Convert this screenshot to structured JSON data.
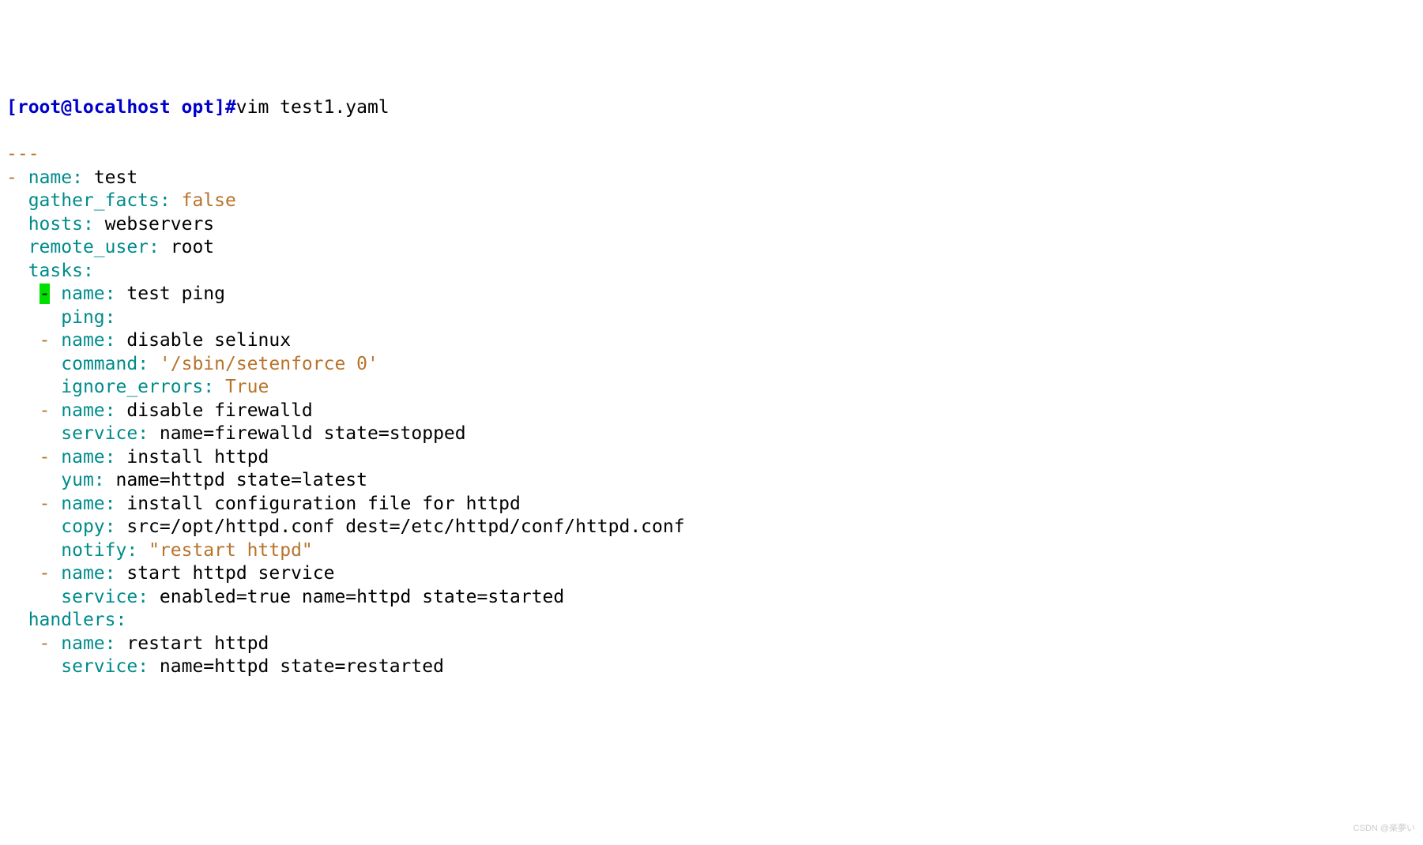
{
  "prompt": "[root@localhost opt]#",
  "command": "vim test1.yaml",
  "doc_start": "---",
  "play": {
    "name_key": "name",
    "name_val": "test",
    "gather_key": "gather_facts",
    "gather_val": "false",
    "hosts_key": "hosts",
    "hosts_val": "webservers",
    "remote_key": "remote_user",
    "remote_val": "root",
    "tasks_key": "tasks"
  },
  "tasks": [
    {
      "name_key": "name",
      "name_val": "test ping",
      "mod_key": "ping"
    },
    {
      "name_key": "name",
      "name_val": "disable selinux",
      "mod_key": "command",
      "mod_val": "'/sbin/setenforce 0'",
      "ignore_key": "ignore_errors",
      "ignore_val": "True"
    },
    {
      "name_key": "name",
      "name_val": "disable firewalld",
      "mod_key": "service",
      "mod_val": "name=firewalld state=stopped"
    },
    {
      "name_key": "name",
      "name_val": "install httpd",
      "mod_key": "yum",
      "mod_val": "name=httpd state=latest"
    },
    {
      "name_key": "name",
      "name_val": "install configuration file for httpd",
      "mod_key": "copy",
      "mod_val": "src=/opt/httpd.conf dest=/etc/httpd/conf/httpd.conf",
      "notify_key": "notify",
      "notify_val": "\"restart httpd\""
    },
    {
      "name_key": "name",
      "name_val": "start httpd service",
      "mod_key": "service",
      "mod_val": "enabled=true name=httpd state=started"
    }
  ],
  "handlers_key": "handlers",
  "handlers": [
    {
      "name_key": "name",
      "name_val": "restart httpd",
      "mod_key": "service",
      "mod_val": "name=httpd state=restarted"
    }
  ],
  "watermark": "CSDN @楽夢い"
}
